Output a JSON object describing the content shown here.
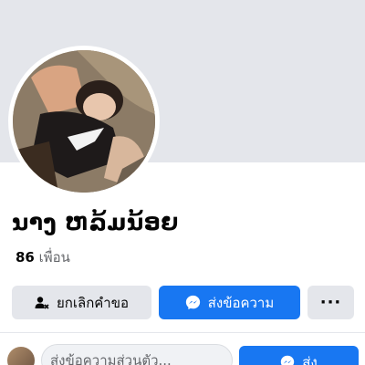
{
  "profile": {
    "name": "ນາງ ຫລ້ມນ້ອຍ",
    "friend_count": "86",
    "friend_label": "เพื่อน"
  },
  "actions": {
    "cancel_request_label": "ยกเลิกคำขอ",
    "message_label": "ส่งข้อความ",
    "more_label": "···"
  },
  "composer": {
    "placeholder": "ส่งข้อความส่วนตัว...",
    "send_label": "ส่ง"
  },
  "colors": {
    "accent": "#1877f2",
    "button_gray": "#e4e6eb",
    "cover": "#e4e6eb"
  },
  "icons": {
    "cancel_request": "person-x-icon",
    "message": "messenger-icon",
    "send": "messenger-icon"
  }
}
